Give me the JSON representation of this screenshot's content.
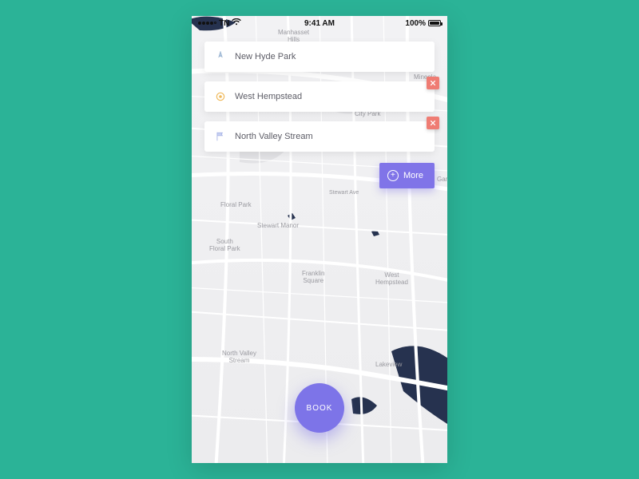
{
  "statusbar": {
    "carrier": "TN",
    "time": "9:41 AM",
    "battery_pct": "100%"
  },
  "destinations": [
    {
      "icon": "gps-icon",
      "label": "New Hyde Park",
      "removable": false
    },
    {
      "icon": "target-icon",
      "label": "West Hempstead",
      "removable": true
    },
    {
      "icon": "flag-icon",
      "label": "North Valley Stream",
      "removable": true
    }
  ],
  "more_button": {
    "label": "More"
  },
  "book_button": {
    "label": "BOOK"
  },
  "map_labels": {
    "manhasset": "Manhasset\nHills",
    "mineola": "Mineola",
    "citypark": "City Park",
    "floral": "Floral Park",
    "stewart": "Stewart Manor",
    "sfloral": "South\nFloral Park",
    "franklin": "Franklin\nSquare",
    "whemp": "West\nHempstead",
    "nvs": "North Valley\nStream",
    "lakeview": "Lakeview",
    "stewart_ave": "Stewart Ave",
    "gar": "Gar"
  }
}
